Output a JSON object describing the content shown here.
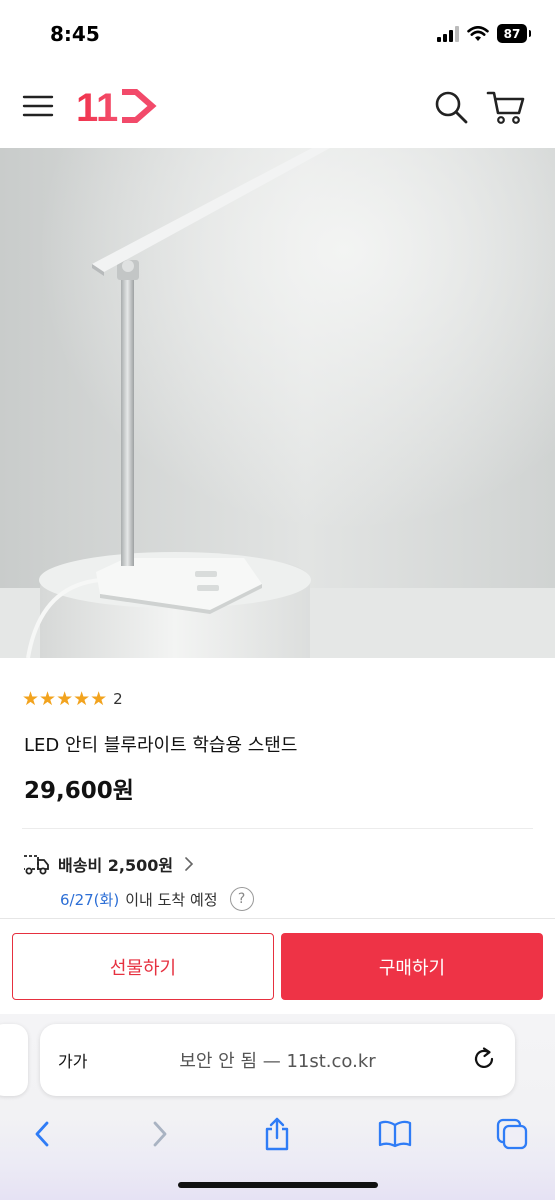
{
  "status_bar": {
    "time": "8:45",
    "battery": "87"
  },
  "header": {
    "logo_text": "11"
  },
  "product": {
    "stars": "★★★★★",
    "rating_value": 5,
    "review_count": "2",
    "title": "LED 안티 블루라이트 학습용 스탠드",
    "price": "29,600원"
  },
  "shipping": {
    "fee": "배송비 2,500원",
    "arrival_date": "6/27(화)",
    "arrival_text": "이내 도착 예정",
    "help": "?"
  },
  "actions": {
    "gift_label": "선물하기",
    "buy_label": "구매하기"
  },
  "browser": {
    "aa_label": "가가",
    "url_text": "보안 안 됨 — 11st.co.kr"
  },
  "icons": {
    "menu": "hamburger-icon",
    "search": "search-icon",
    "cart": "cart-icon",
    "truck": "truck-icon",
    "reload": "reload-icon",
    "back": "chevron-left-icon",
    "forward": "chevron-right-icon",
    "share": "share-icon",
    "bookmarks": "book-icon",
    "tabs": "tabs-icon"
  },
  "colors": {
    "brand_red": "#ee3346",
    "star": "#f2a31e",
    "date_blue": "#2d6fd6",
    "safari_blue": "#2f7cf6"
  }
}
